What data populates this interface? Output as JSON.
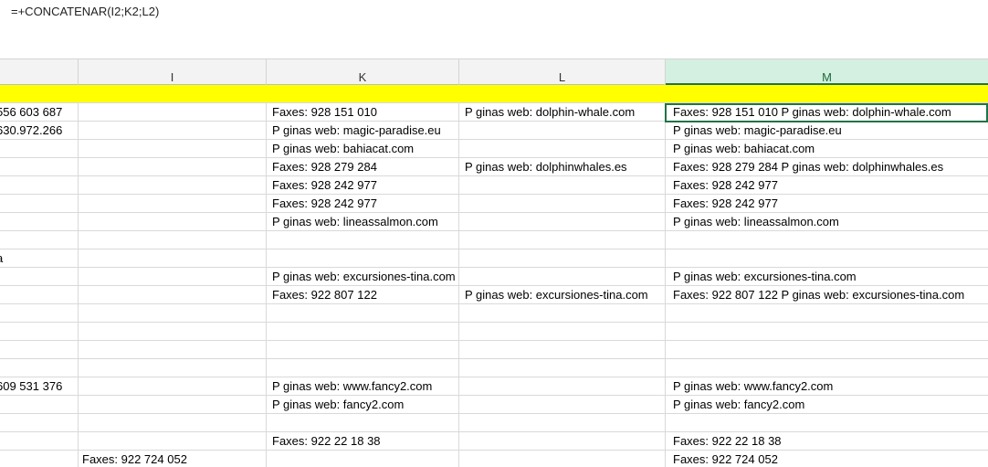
{
  "formula_bar": {
    "text": "=+CONCATENAR(I2;K2;L2)"
  },
  "columns": [
    {
      "label": ""
    },
    {
      "label": "I"
    },
    {
      "label": "K"
    },
    {
      "label": "L"
    },
    {
      "label": "M"
    }
  ],
  "rows": [
    [
      "",
      "",
      "",
      "",
      ""
    ],
    [
      "556 603 687",
      "",
      "Faxes: 928 151 010",
      "P ginas web: dolphin-whale.com",
      "Faxes: 928 151 010 P ginas web: dolphin-whale.com"
    ],
    [
      "630.972.266",
      "",
      "P ginas web: magic-paradise.eu",
      "",
      "P ginas web: magic-paradise.eu"
    ],
    [
      "",
      "",
      "P ginas web: bahiacat.com",
      "",
      "P ginas web: bahiacat.com"
    ],
    [
      "",
      "",
      "Faxes: 928 279 284",
      "P ginas web: dolphinwhales.es",
      "Faxes: 928 279 284 P ginas web: dolphinwhales.es"
    ],
    [
      "",
      "",
      "Faxes: 928 242 977",
      "",
      "Faxes: 928 242 977"
    ],
    [
      "",
      "",
      "Faxes: 928 242 977",
      "",
      "Faxes: 928 242 977"
    ],
    [
      "",
      "",
      "P ginas web: lineassalmon.com",
      "",
      "P ginas web: lineassalmon.com"
    ],
    [
      "",
      "",
      "",
      "",
      ""
    ],
    [
      "a",
      "",
      "",
      "",
      ""
    ],
    [
      "",
      "",
      "P ginas web: excursiones-tina.com",
      "",
      "P ginas web: excursiones-tina.com"
    ],
    [
      "",
      "",
      "Faxes: 922 807 122",
      "P ginas web: excursiones-tina.com",
      "Faxes: 922 807 122 P ginas web: excursiones-tina.com"
    ],
    [
      "",
      "",
      "",
      "",
      ""
    ],
    [
      "",
      "",
      "",
      "",
      ""
    ],
    [
      "",
      "",
      "",
      "",
      ""
    ],
    [
      "",
      "",
      "",
      "",
      ""
    ],
    [
      "609 531 376",
      "",
      "P ginas web: www.fancy2.com",
      "",
      "P ginas web: www.fancy2.com"
    ],
    [
      "",
      "",
      "P ginas web: fancy2.com",
      "",
      "P ginas web: fancy2.com"
    ],
    [
      "",
      "",
      "",
      "",
      ""
    ],
    [
      "",
      "",
      "Faxes: 922 22 18 38",
      "",
      "Faxes: 922 22 18 38"
    ],
    [
      "",
      "Faxes: 922 724 052",
      "",
      "",
      "Faxes: 922 724 052"
    ]
  ]
}
